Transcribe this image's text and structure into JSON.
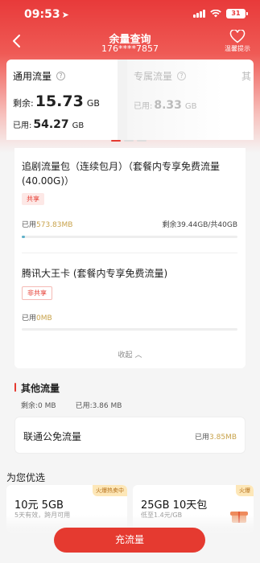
{
  "status_bar": {
    "time": "09:53",
    "battery": "31"
  },
  "nav": {
    "title": "余量查询",
    "phone": "176****7857",
    "tip_label": "温馨提示"
  },
  "tabs": [
    {
      "name": "通用流量",
      "remain_label": "剩余:",
      "remain_value": "15.73",
      "remain_unit": "GB",
      "used_label": "已用:",
      "used_value": "54.27",
      "used_unit": "GB"
    },
    {
      "name": "专属流量",
      "used_label": "已用:",
      "used_value": "8.33",
      "used_unit": "GB"
    },
    {
      "name": "其"
    }
  ],
  "packages": [
    {
      "title": "追剧流量包（连续包月）（套餐内专享免费流量(40.00G)）",
      "badge": "共享",
      "used_label": "已用",
      "used_value": "573.83MB",
      "remain": "剩余39.44GB/共40GB",
      "progress": 0.014
    },
    {
      "title": "腾讯大王卡 (套餐内专享免费流量)",
      "badge": "非共享",
      "used_label": "已用",
      "used_value": "0MB",
      "progress": 0
    }
  ],
  "collapse_label": "收起",
  "other": {
    "title": "其他流量",
    "remain": "剩余:0 MB",
    "used": "已用:3.86 MB"
  },
  "unicom": {
    "name": "联通公免流量",
    "used_label": "已用",
    "used_value": "3.85MB"
  },
  "recommend": {
    "title": "为您优选",
    "items": [
      {
        "tag": "火爆热卖中",
        "name": "10元 5GB",
        "desc": "5天有效，跨月可用"
      },
      {
        "tag": "火爆",
        "name": "25GB 10天包",
        "desc": "低至1.4元/GB"
      }
    ]
  },
  "charge_button": "充流量",
  "colors": {
    "brand_red": "#e53a30",
    "gold": "#c8a24a",
    "progress": "#5fb1c9"
  }
}
